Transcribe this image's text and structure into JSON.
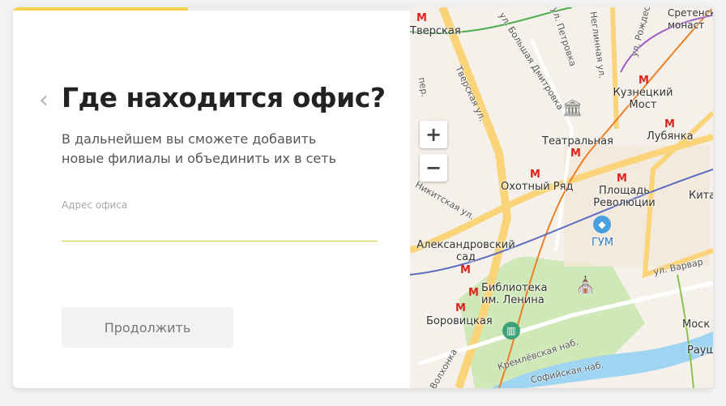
{
  "progress": 0.5,
  "form": {
    "back_icon": "chevron-left-icon",
    "title": "Где находится офис?",
    "subtitle": "В дальнейшем вы сможете добавить новые филиалы и объединить их в сеть",
    "address_label": "Адрес офиса",
    "address_value": "",
    "continue_label": "Продолжить"
  },
  "map": {
    "zoom_in": "+",
    "zoom_out": "−",
    "metro_symbol": "M",
    "stations": [
      "Тверская",
      "Кузнецкий Мост",
      "Театральная",
      "Лубянка",
      "Охотный Ряд",
      "Площадь Революции",
      "Китай",
      "Александровский сад",
      "Библиотека им. Ленина",
      "Боровицкая",
      "Сретенский монаст"
    ],
    "places": [
      "ГУМ",
      "Моск",
      "Раушская"
    ],
    "streets": [
      "Тверская ул.",
      "ул. Петровка",
      "ул. Большая Дмитровка",
      "Неглинная ул.",
      "ул. Рождест",
      "ул. Варвар",
      "Кремлёвская наб.",
      "Софийская наб.",
      "Волхонка",
      "Никитская ул.",
      "пер."
    ],
    "colors": {
      "metro": "#e0221f",
      "progress": "#f7d24f",
      "park": "#cfe8b7",
      "river": "#9fd4f2"
    }
  }
}
